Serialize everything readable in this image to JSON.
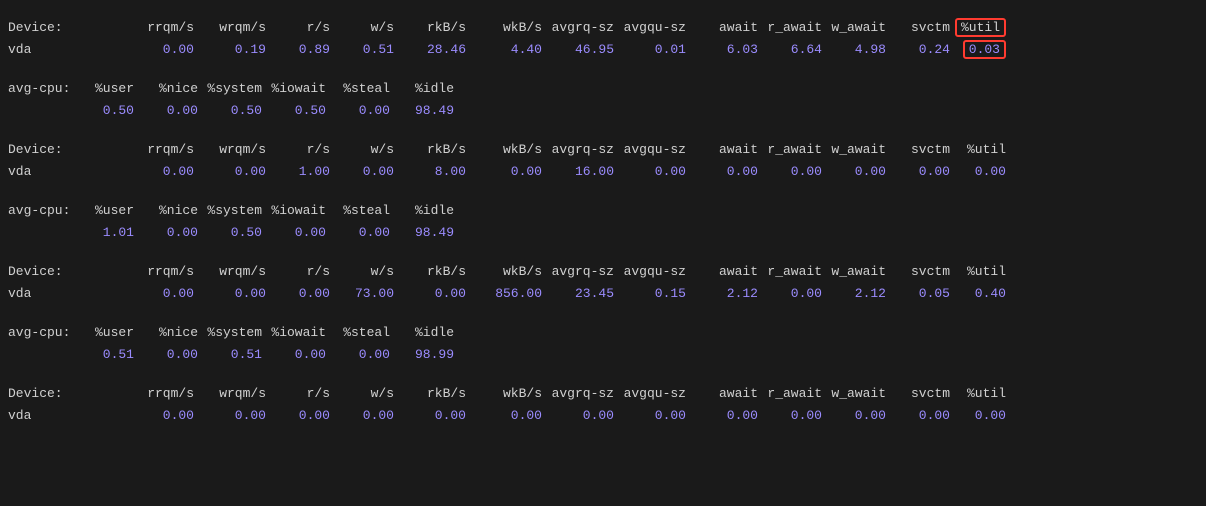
{
  "device_headers": [
    "Device:",
    "rrqm/s",
    "wrqm/s",
    "r/s",
    "w/s",
    "rkB/s",
    "wkB/s",
    "avgrq-sz",
    "avgqu-sz",
    "await",
    "r_await",
    "w_await",
    "svctm",
    "%util"
  ],
  "cpu_headers": [
    "avg-cpu:",
    "%user",
    "%nice",
    "%system",
    "%iowait",
    "%steal",
    "%idle"
  ],
  "blocks": [
    {
      "type": "device",
      "highlight_util": true,
      "name": "vda",
      "values": [
        "0.00",
        "0.19",
        "0.89",
        "0.51",
        "28.46",
        "4.40",
        "46.95",
        "0.01",
        "6.03",
        "6.64",
        "4.98",
        "0.24",
        "0.03"
      ]
    },
    {
      "type": "cpu",
      "values": [
        "0.50",
        "0.00",
        "0.50",
        "0.50",
        "0.00",
        "98.49"
      ]
    },
    {
      "type": "device",
      "highlight_util": false,
      "name": "vda",
      "values": [
        "0.00",
        "0.00",
        "1.00",
        "0.00",
        "8.00",
        "0.00",
        "16.00",
        "0.00",
        "0.00",
        "0.00",
        "0.00",
        "0.00",
        "0.00"
      ]
    },
    {
      "type": "cpu",
      "values": [
        "1.01",
        "0.00",
        "0.50",
        "0.00",
        "0.00",
        "98.49"
      ]
    },
    {
      "type": "device",
      "highlight_util": false,
      "name": "vda",
      "values": [
        "0.00",
        "0.00",
        "0.00",
        "73.00",
        "0.00",
        "856.00",
        "23.45",
        "0.15",
        "2.12",
        "0.00",
        "2.12",
        "0.05",
        "0.40"
      ]
    },
    {
      "type": "cpu",
      "values": [
        "0.51",
        "0.00",
        "0.51",
        "0.00",
        "0.00",
        "98.99"
      ]
    },
    {
      "type": "device",
      "highlight_util": false,
      "name": "vda",
      "values": [
        "0.00",
        "0.00",
        "0.00",
        "0.00",
        "0.00",
        "0.00",
        "0.00",
        "0.00",
        "0.00",
        "0.00",
        "0.00",
        "0.00",
        "0.00"
      ]
    }
  ]
}
